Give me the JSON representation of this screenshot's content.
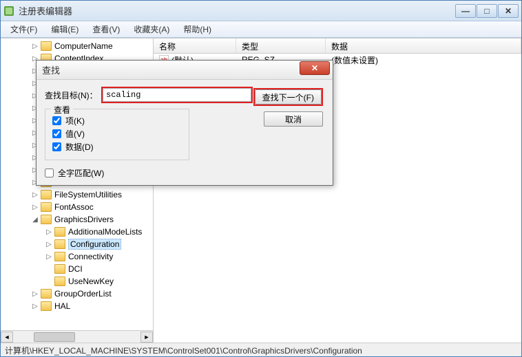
{
  "window": {
    "title": "注册表编辑器"
  },
  "menu": {
    "file": "文件(F)",
    "edit": "编辑(E)",
    "view": "查看(V)",
    "favorites": "收藏夹(A)",
    "help": "帮助(H)"
  },
  "tree": {
    "items": [
      {
        "depth": 2,
        "expand": "▷",
        "label": "ComputerName"
      },
      {
        "depth": 2,
        "expand": "▷",
        "label": "ContentIndex"
      },
      {
        "depth": 2,
        "expand": "▷",
        "label": ""
      },
      {
        "depth": 2,
        "expand": "▷",
        "label": ""
      },
      {
        "depth": 2,
        "expand": "▷",
        "label": ""
      },
      {
        "depth": 2,
        "expand": "▷",
        "label": ""
      },
      {
        "depth": 2,
        "expand": "▷",
        "label": ""
      },
      {
        "depth": 2,
        "expand": "▷",
        "label": ""
      },
      {
        "depth": 2,
        "expand": "▷",
        "label": ""
      },
      {
        "depth": 2,
        "expand": "▷",
        "label": ""
      },
      {
        "depth": 2,
        "expand": "▷",
        "label": ""
      },
      {
        "depth": 2,
        "expand": "▷",
        "label": ""
      },
      {
        "depth": 2,
        "expand": "▷",
        "label": "FileSystemUtilities"
      },
      {
        "depth": 2,
        "expand": "▷",
        "label": "FontAssoc"
      },
      {
        "depth": 2,
        "expand": "◢",
        "label": "GraphicsDrivers"
      },
      {
        "depth": 3,
        "expand": "▷",
        "label": "AdditionalModeLists"
      },
      {
        "depth": 3,
        "expand": "▷",
        "label": "Configuration",
        "selected": true
      },
      {
        "depth": 3,
        "expand": "▷",
        "label": "Connectivity"
      },
      {
        "depth": 3,
        "expand": "",
        "label": "DCI"
      },
      {
        "depth": 3,
        "expand": "",
        "label": "UseNewKey"
      },
      {
        "depth": 2,
        "expand": "▷",
        "label": "GroupOrderList"
      },
      {
        "depth": 2,
        "expand": "▷",
        "label": "HAL"
      }
    ]
  },
  "list": {
    "headers": {
      "name": "名称",
      "type": "类型",
      "data": "数据"
    },
    "rows": [
      {
        "name": "(默认)",
        "type": "REG_SZ",
        "data": "(数值未设置)"
      }
    ]
  },
  "dialog": {
    "title": "查找",
    "find_label": "查找目标(N)：",
    "find_value": "scaling",
    "find_next": "查找下一个(F)",
    "cancel": "取消",
    "group_legend": "查看",
    "chk_keys": "项(K)",
    "chk_values": "值(V)",
    "chk_data": "数据(D)",
    "chk_wholeword": "全字匹配(W)"
  },
  "statusbar": {
    "path": "计算机\\HKEY_LOCAL_MACHINE\\SYSTEM\\ControlSet001\\Control\\GraphicsDrivers\\Configuration"
  }
}
